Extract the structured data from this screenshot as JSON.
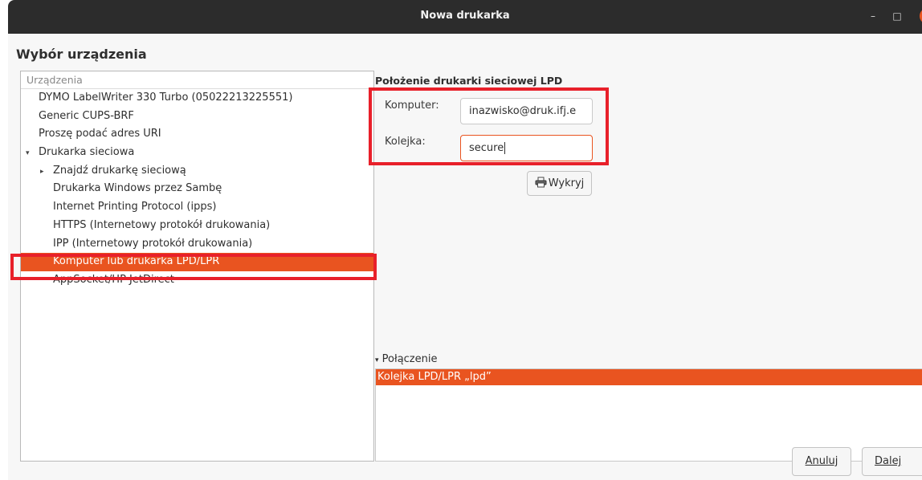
{
  "window": {
    "title": "Nowa drukarka",
    "controls": {
      "minimize": "–",
      "maximize": "□",
      "close": "×"
    }
  },
  "heading": "Wybór urządzenia",
  "devices": {
    "column_header": "Urządzenia",
    "items": [
      {
        "label": "DYMO LabelWriter 330 Turbo (05022213225551)"
      },
      {
        "label": "Generic CUPS-BRF"
      },
      {
        "label": "Proszę podać adres URI"
      },
      {
        "label": "Drukarka sieciowa",
        "expander": "▾"
      },
      {
        "label": "Znajdź drukarkę sieciową",
        "expander": "▸"
      },
      {
        "label": "Drukarka Windows przez Sambę"
      },
      {
        "label": "Internet Printing Protocol (ipps)"
      },
      {
        "label": "HTTPS (Internetowy protokół drukowania)"
      },
      {
        "label": "IPP (Internetowy protokół drukowania)"
      },
      {
        "label": "Komputer lub drukarka LPD/LPR",
        "selected": true
      },
      {
        "label": "AppSocket/HP JetDirect"
      }
    ]
  },
  "lpd": {
    "section_title": "Położenie drukarki sieciowej LPD",
    "host_label": "Komputer:",
    "host_value": "inazwisko@druk.ifj.e",
    "queue_label": "Kolejka:",
    "queue_value": "secure",
    "probe_button": "Wykryj"
  },
  "connection": {
    "header": "Połączenie",
    "expander": "▾",
    "items": [
      {
        "label": "Kolejka LPD/LPR „lpd”",
        "selected": true
      }
    ]
  },
  "buttons": {
    "cancel_label": "Anuluj",
    "next_label": "Dalej"
  },
  "colors": {
    "accent": "#e95420",
    "highlight": "#e8202a",
    "titlebar": "#2c2c2c"
  },
  "icons": {
    "probe": "printer-icon",
    "expanded": "triangle-down-icon",
    "collapsed": "triangle-right-icon"
  }
}
